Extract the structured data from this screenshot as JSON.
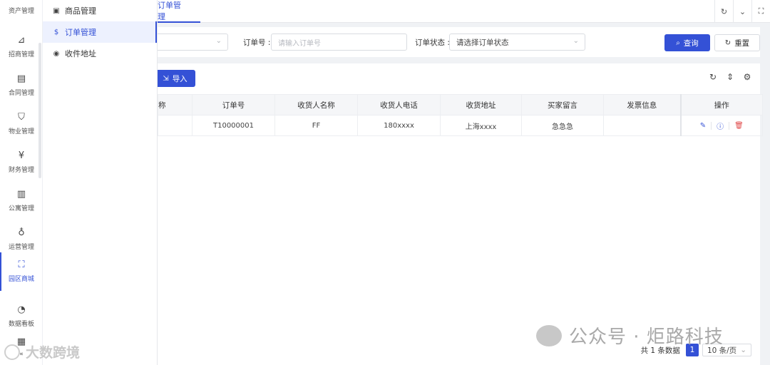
{
  "rail": {
    "items": [
      {
        "label": "资产管理",
        "icon": "asset-icon",
        "glyph": ""
      },
      {
        "label": "招商管理",
        "icon": "chart-icon",
        "glyph": "⊿"
      },
      {
        "label": "合同管理",
        "icon": "contract-icon",
        "glyph": "▤"
      },
      {
        "label": "物业管理",
        "icon": "shield-icon",
        "glyph": "⛉"
      },
      {
        "label": "财务管理",
        "icon": "yen-icon",
        "glyph": "¥"
      },
      {
        "label": "公寓管理",
        "icon": "building-icon",
        "glyph": "▥"
      },
      {
        "label": "运营管理",
        "icon": "bulb-icon",
        "glyph": "♁"
      },
      {
        "label": "园区商城",
        "icon": "bag-icon",
        "glyph": "⛶"
      },
      {
        "label": "数据看板",
        "icon": "gauge-icon",
        "glyph": "◔"
      },
      {
        "label": "",
        "icon": "grid-icon",
        "glyph": "▦"
      }
    ],
    "collapse_glyph": "«"
  },
  "submenu": {
    "items": [
      {
        "label": "商品管理",
        "icon": "goods-icon",
        "glyph": "▣"
      },
      {
        "label": "订单管理",
        "icon": "dollar-icon",
        "glyph": "$"
      },
      {
        "label": "收件地址",
        "icon": "location-icon",
        "glyph": "◉"
      }
    ]
  },
  "tabs": {
    "active": "订单管理"
  },
  "search": {
    "order_no_label": "订单号 :",
    "order_no_placeholder": "请输入订单号",
    "status_label": "订单状态 :",
    "status_placeholder": "请选择订单状态",
    "query_label": "查询",
    "reset_label": "重置"
  },
  "toolbar": {
    "import_label": "导入"
  },
  "table": {
    "columns": [
      "称",
      "订单号",
      "收货人名称",
      "收货人电话",
      "收货地址",
      "买家留言",
      "发票信息",
      "操作"
    ],
    "rows": [
      {
        "name": "",
        "order_no": "T10000001",
        "receiver": "FF",
        "phone": "180xxxx",
        "address": "上海xxxx",
        "message": "急急急",
        "invoice": ""
      }
    ]
  },
  "pagination": {
    "total": "共 1 条数据",
    "page": "1",
    "page_size": "10 条/页"
  },
  "watermark": {
    "right": "公众号 · 炬路科技",
    "left": "大数跨境"
  },
  "colors": {
    "primary": "#3451d6",
    "danger": "#e04848"
  }
}
